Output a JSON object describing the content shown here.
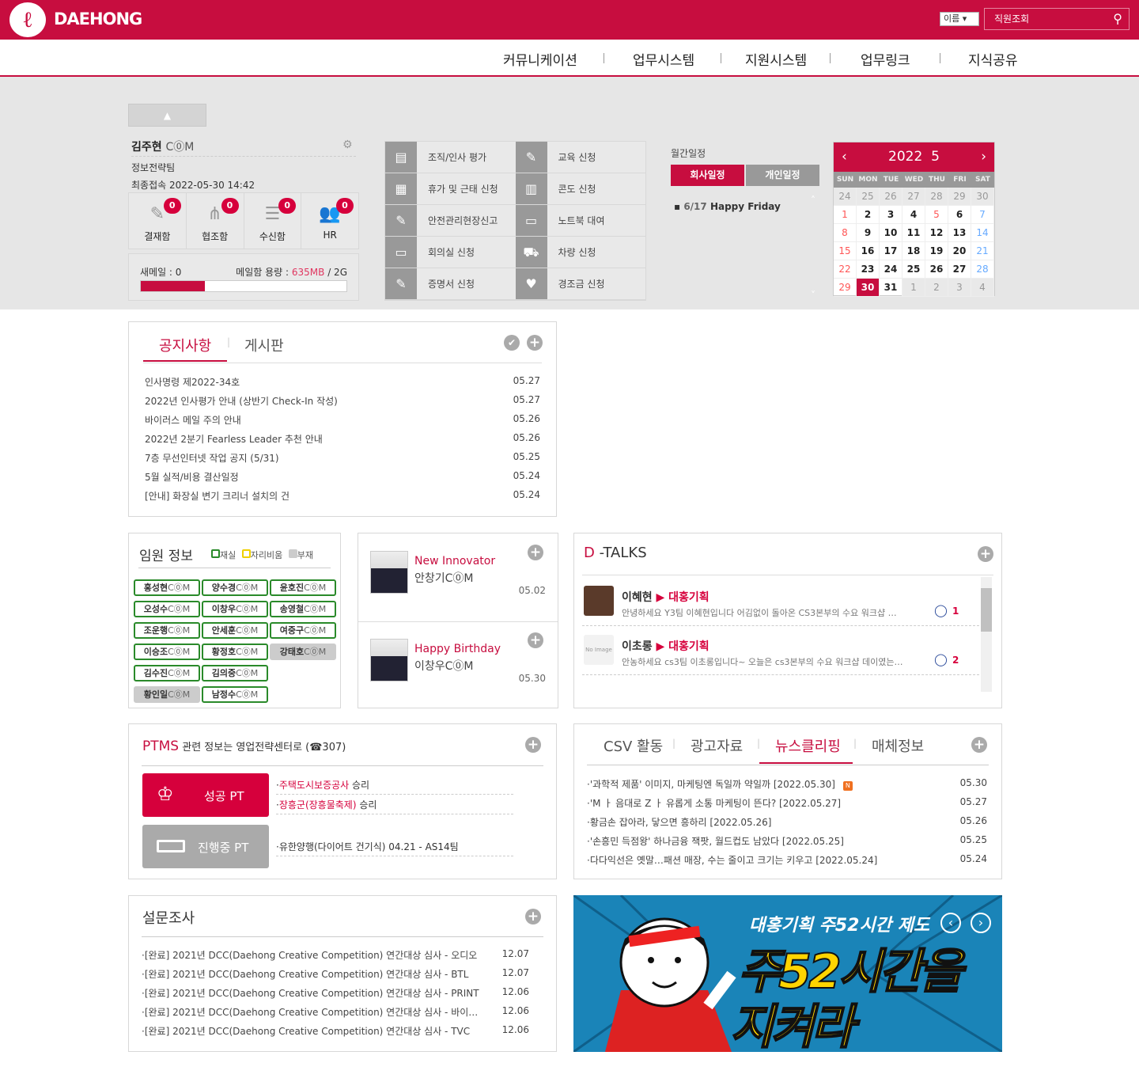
{
  "header": {
    "logo_text": "DAEHONG",
    "search_type": "이름",
    "search_placeholder": "직원조회"
  },
  "nav": [
    "커뮤니케이션",
    "업무시스템",
    "지원시스템",
    "업무링크",
    "지식공유"
  ],
  "user": {
    "name": "김주현",
    "title": "C⓪M",
    "dept": "정보전략팀",
    "last_login": "최종접속 2022-05-30 14:42",
    "boxes": [
      {
        "label": "결재함",
        "count": "0",
        "icon": "approval-icon"
      },
      {
        "label": "협조함",
        "count": "0",
        "icon": "share-icon"
      },
      {
        "label": "수신함",
        "count": "0",
        "icon": "inbox-icon"
      },
      {
        "label": "HR",
        "count": "0",
        "icon": "users-icon"
      }
    ],
    "new_mail": "새메일 : 0",
    "mail_capacity_label": "메일함 용량 :",
    "mail_used": "635MB",
    "mail_total": "/ 2G",
    "mail_used_fraction": 0.31
  },
  "quick_menu": [
    "조직/인사 평가",
    "교육 신청",
    "휴가 및 근태 신청",
    "콘도 신청",
    "안전관리현장신고",
    "노트북 대여",
    "회의실 신청",
    "차량 신청",
    "증명서 신청",
    "경조금 신청"
  ],
  "schedule": {
    "title": "월간일정",
    "tabs": [
      "회사일정",
      "개인일정"
    ],
    "events": [
      {
        "date": "6/17",
        "title": "Happy Friday"
      }
    ]
  },
  "calendar": {
    "year": "2022",
    "month": "5",
    "dow": [
      "SUN",
      "MON",
      "TUE",
      "WED",
      "THU",
      "FRI",
      "SAT"
    ],
    "days": [
      "24",
      "25",
      "26",
      "27",
      "28",
      "29",
      "30",
      "1",
      "2",
      "3",
      "4",
      "5",
      "6",
      "7",
      "8",
      "9",
      "10",
      "11",
      "12",
      "13",
      "14",
      "15",
      "16",
      "17",
      "18",
      "19",
      "20",
      "21",
      "22",
      "23",
      "24",
      "25",
      "26",
      "27",
      "28",
      "29",
      "30",
      "31",
      "1",
      "2",
      "3",
      "4"
    ],
    "today": "30",
    "holiday": "5"
  },
  "notice": {
    "tabs": [
      "공지사항",
      "게시판"
    ],
    "items": [
      {
        "t": "인사명령 제2022-34호",
        "d": "05.27"
      },
      {
        "t": "2022년 인사평가 안내 (상반기 Check-In 작성)",
        "d": "05.27"
      },
      {
        "t": "바이러스 메일 주의 안내",
        "d": "05.26"
      },
      {
        "t": "2022년 2분기 Fearless Leader 추천 안내",
        "d": "05.26"
      },
      {
        "t": "7층 무선인터넷 작업 공지 (5/31)",
        "d": "05.25"
      },
      {
        "t": "5월 실적/비용 결산일정",
        "d": "05.24"
      },
      {
        "t": "[안내] 화장실 변기 크리너 설치의 건",
        "d": "05.24"
      }
    ]
  },
  "executives": {
    "title": "임원 정보",
    "legend": [
      "재실",
      "자리비움",
      "부재"
    ],
    "title_suffix": "C⓪M",
    "people": [
      {
        "n": "홍성현",
        "s": "in"
      },
      {
        "n": "양수경",
        "s": "in"
      },
      {
        "n": "윤호진",
        "s": "in"
      },
      {
        "n": "오성수",
        "s": "in"
      },
      {
        "n": "이창우",
        "s": "in"
      },
      {
        "n": "송영철",
        "s": "in"
      },
      {
        "n": "조운행",
        "s": "in"
      },
      {
        "n": "안세훈",
        "s": "in"
      },
      {
        "n": "여중구",
        "s": "in"
      },
      {
        "n": "이승조",
        "s": "in"
      },
      {
        "n": "황정호",
        "s": "in"
      },
      {
        "n": "강태호",
        "s": "out"
      },
      {
        "n": "김수진",
        "s": "in"
      },
      {
        "n": "김의중",
        "s": "in"
      },
      {
        "n": "황인일",
        "s": "out"
      },
      {
        "n": "남정수",
        "s": "in"
      }
    ]
  },
  "people_news": [
    {
      "tag": "New Innovator",
      "name": "안창기C⓪M",
      "date": "05.02"
    },
    {
      "tag": "Happy Birthday",
      "name": "이창우C⓪M",
      "date": "05.30"
    }
  ],
  "dtalks": {
    "title_d": "D",
    "title": "-TALKS",
    "items": [
      {
        "name": "이혜현",
        "team": "대홍기획",
        "text": "안녕하세요 Y3팀 이혜현입니다 어김없이 돌아온 CS3본부의 수요 워크샵 …",
        "comments": "1"
      },
      {
        "name": "이초롱",
        "team": "대홍기획",
        "text": "안농하세요 cs3팀 이초롱입니다~ 오늘은 cs3본부의 수요 워크샵 데이였는…",
        "comments": "2"
      }
    ],
    "no_image": "No Image"
  },
  "ptms": {
    "title_red": "PTMS",
    "title": "관련 정보는 영업전략센터로 (☎307)",
    "success_label": "성공 PT",
    "progress_label": "진행중 PT",
    "success": [
      {
        "red": "주택도시보증공사",
        "rest": "승리"
      },
      {
        "red": "장흥군(장흥물축제)",
        "rest": "승리"
      }
    ],
    "progress": [
      "유한양행(다이어트 건기식) 04.21 - AS14팀"
    ]
  },
  "clipping": {
    "tabs": [
      "CSV 활동",
      "광고자료",
      "뉴스클리핑",
      "매체정보"
    ],
    "active": 2,
    "items": [
      {
        "t": "'과학적 제품' 이미지, 마케팅엔 독일까 약일까 [2022.05.30]",
        "d": "05.30",
        "new": "N"
      },
      {
        "t": "'M ㅏ 음대로 Z ㅏ 유롭게 소통 마케팅이 뜬다? [2022.05.27]",
        "d": "05.27"
      },
      {
        "t": "황금손 잡아라, 닿으면 흥하리 [2022.05.26]",
        "d": "05.26"
      },
      {
        "t": "'손흥민 득점왕' 하나금융 잭팟, 월드컵도 남았다 [2022.05.25]",
        "d": "05.25"
      },
      {
        "t": "다다익선은 옛말…패션 매장, 수는 줄이고 크기는 키우고 [2022.05.24]",
        "d": "05.24"
      }
    ]
  },
  "survey": {
    "title": "설문조사",
    "items": [
      {
        "t": "[완료] 2021년 DCC(Daehong Creative Competition) 연간대상 심사 - 오디오",
        "d": "12.07"
      },
      {
        "t": "[완료] 2021년 DCC(Daehong Creative Competition) 연간대상 심사 - BTL",
        "d": "12.07"
      },
      {
        "t": "[완료] 2021년 DCC(Daehong Creative Competition) 연간대상 심사 - PRINT",
        "d": "12.06"
      },
      {
        "t": "[완료] 2021년 DCC(Daehong Creative Competition) 연간대상 심사 - 바이…",
        "d": "12.06"
      },
      {
        "t": "[완료] 2021년 DCC(Daehong Creative Competition) 연간대상 심사 - TVC",
        "d": "12.06"
      }
    ]
  },
  "banner": {
    "line1": "대홍기획 주52시간 제도",
    "line2": "주52시간을",
    "line3": "지켜라"
  },
  "colors": {
    "brand": "#c70d3f",
    "present": "#2a8a2a",
    "away": "#f0d000",
    "absent": "#cccccc"
  }
}
